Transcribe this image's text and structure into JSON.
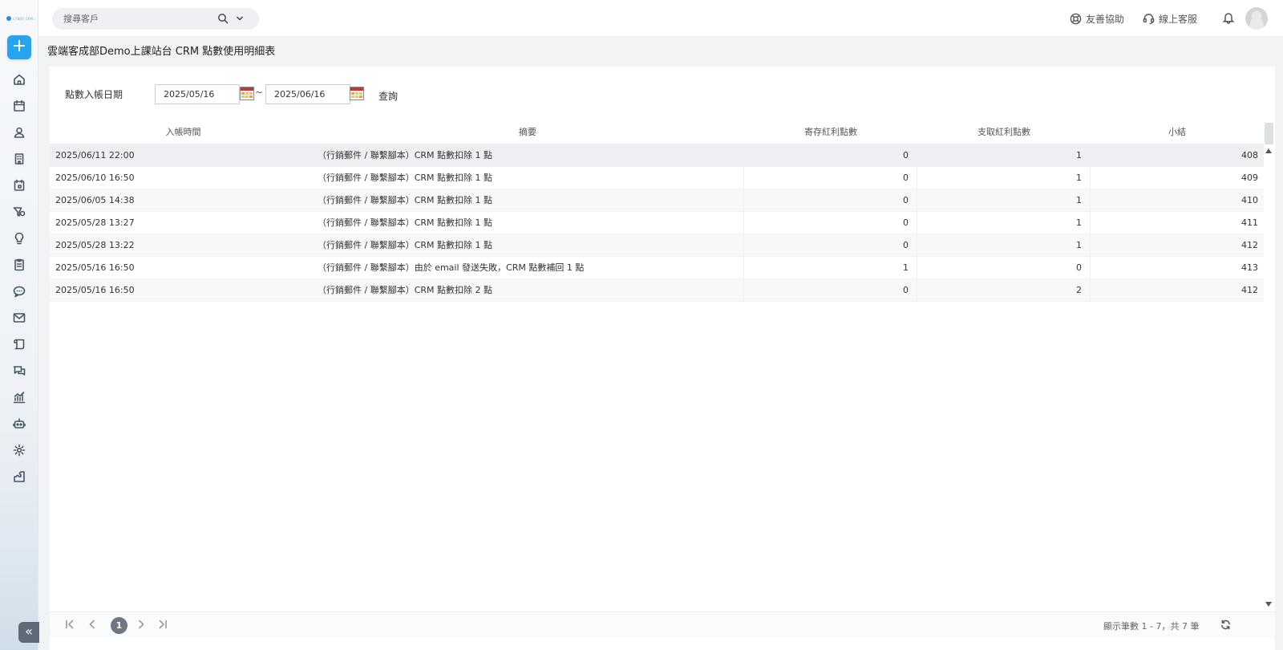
{
  "sidebar": {
    "logo_text": "CYBER CRM",
    "add_label": "+",
    "collapse_label": "«",
    "nav_icons": [
      "home-icon",
      "calendar-icon",
      "contacts-icon",
      "building-icon",
      "event-icon",
      "marketing-icon",
      "idea-icon",
      "document-icon",
      "chat-icon",
      "mail-icon",
      "script-icon",
      "conversation-icon",
      "analytics-icon",
      "robot-icon",
      "gear-icon",
      "plugin-icon"
    ]
  },
  "topbar": {
    "search_placeholder": "搜尋客戶",
    "help_label": "友善協助",
    "support_label": "線上客服"
  },
  "page": {
    "title": "雲端客成部Demo上課站台 CRM 點數使用明細表"
  },
  "filter": {
    "label": "點數入帳日期",
    "start_date": "2025/05/16",
    "separator": "~",
    "end_date": "2025/06/16",
    "query_label": "查詢"
  },
  "table": {
    "headers": [
      "入帳時間",
      "摘要",
      "寄存紅利點數",
      "支取紅利點數",
      "小結"
    ],
    "rows": [
      {
        "time": "2025/06/11 22:00",
        "summary": "（行銷郵件 / 聯繫腳本）CRM 點數扣除 1 點",
        "deposit": "0",
        "withdraw": "1",
        "subtotal": "408"
      },
      {
        "time": "2025/06/10 16:50",
        "summary": "（行銷郵件 / 聯繫腳本）CRM 點數扣除 1 點",
        "deposit": "0",
        "withdraw": "1",
        "subtotal": "409"
      },
      {
        "time": "2025/06/05 14:38",
        "summary": "（行銷郵件 / 聯繫腳本）CRM 點數扣除 1 點",
        "deposit": "0",
        "withdraw": "1",
        "subtotal": "410"
      },
      {
        "time": "2025/05/28 13:27",
        "summary": "（行銷郵件 / 聯繫腳本）CRM 點數扣除 1 點",
        "deposit": "0",
        "withdraw": "1",
        "subtotal": "411"
      },
      {
        "time": "2025/05/28 13:22",
        "summary": "（行銷郵件 / 聯繫腳本）CRM 點數扣除 1 點",
        "deposit": "0",
        "withdraw": "1",
        "subtotal": "412"
      },
      {
        "time": "2025/05/16 16:50",
        "summary": "（行銷郵件 / 聯繫腳本）由於 email 發送失敗，CRM 點數補回 1 點",
        "deposit": "1",
        "withdraw": "0",
        "subtotal": "413"
      },
      {
        "time": "2025/05/16 16:50",
        "summary": "（行銷郵件 / 聯繫腳本）CRM 點數扣除 2 點",
        "deposit": "0",
        "withdraw": "2",
        "subtotal": "412"
      }
    ]
  },
  "pager": {
    "current_page": "1",
    "info": "顯示筆數 1 - 7，共 7 筆"
  },
  "colors": {
    "accent": "#29a3ee",
    "pager_active": "#707780"
  }
}
